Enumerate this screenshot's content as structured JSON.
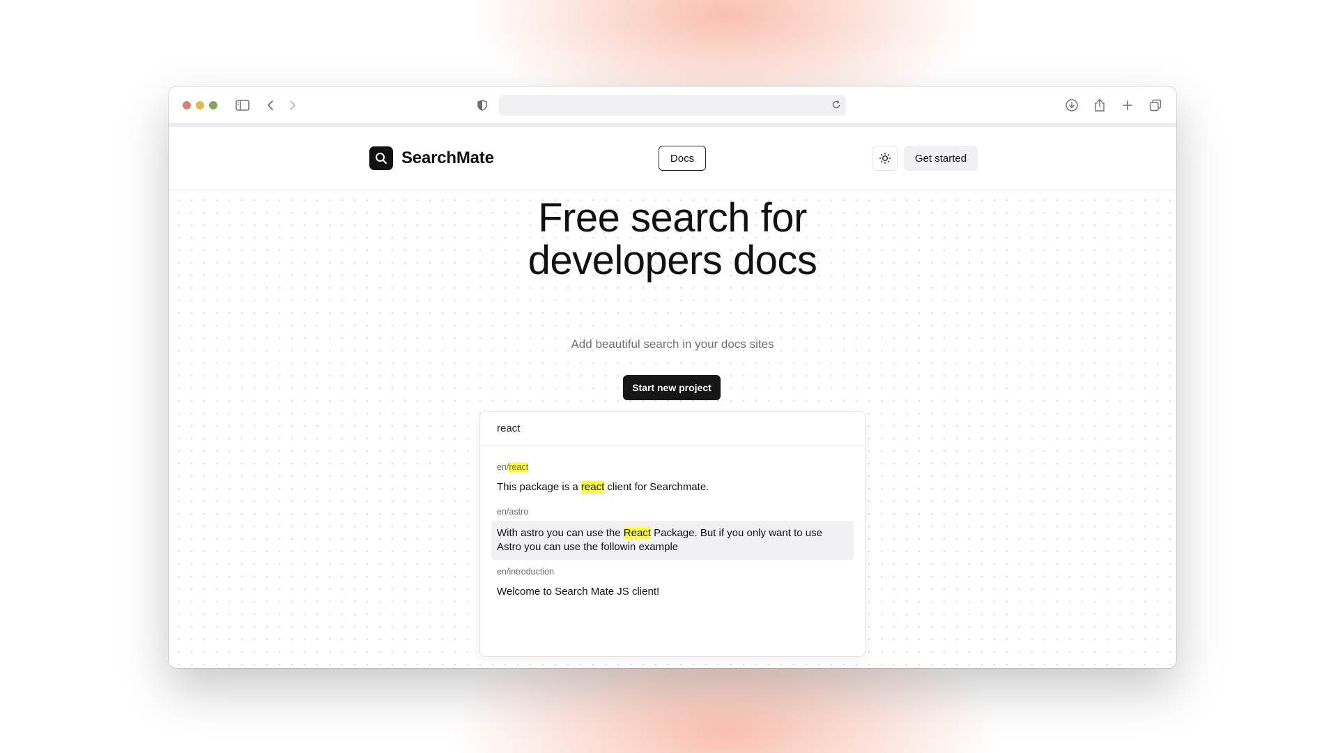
{
  "browser": {
    "icons": [
      "sidebar-icon",
      "back-icon",
      "forward-icon",
      "shield-icon",
      "reload-icon",
      "download-icon",
      "share-icon",
      "new-tab-icon",
      "tabs-overview-icon"
    ]
  },
  "header": {
    "logo_text": "SearchMate",
    "docs_label": "Docs",
    "theme_icon": "sun-icon",
    "get_started_label": "Get started"
  },
  "hero": {
    "title_line1": "Free search for",
    "title_line2": "developers docs",
    "subtitle": "Add beautiful search in your docs sites",
    "cta_label": "Start new project"
  },
  "search": {
    "query": "react",
    "results": [
      {
        "path_prefix": "en/",
        "path_highlight": "react",
        "text_before": "This package is a ",
        "text_highlight": "react",
        "text_after": " client for Searchmate."
      },
      {
        "path": "en/astro",
        "text_before": "With astro you can use the ",
        "text_highlight": "React",
        "text_after": " Package. But if you only want to use Astro you can use the followin example"
      },
      {
        "path": "en/introduction",
        "text": "Welcome to Search Mate JS client!"
      }
    ]
  },
  "colors": {
    "accent_dark": "#161616",
    "highlight": "#ffff3c",
    "backdrop_glow": "#f48c6e"
  }
}
